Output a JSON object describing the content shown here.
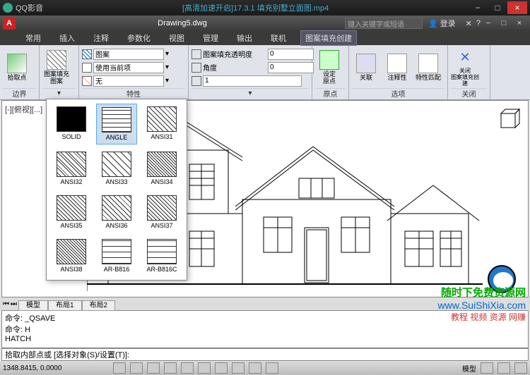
{
  "player": {
    "name": "QQ影音",
    "video_title": "[高清加速开启]17.3.1 填充别墅立面图.mp4"
  },
  "cad": {
    "doc": "Drawing5.dwg",
    "search_placeholder": "键入关键字或短语",
    "user": "登录",
    "menu": [
      "常用",
      "插入",
      "注释",
      "参数化",
      "视图",
      "管理",
      "输出",
      "联机",
      "图案填充创建"
    ],
    "active_menu": 8
  },
  "ribbon": {
    "pick": {
      "label": "拾取点",
      "panel": "边界"
    },
    "pattern_btn": "图案填充\n图案",
    "props": {
      "type": "图案",
      "use_current": "使用当前项",
      "none": "无",
      "panel": "特性"
    },
    "trans": {
      "label": "图案填充透明度",
      "val": "0"
    },
    "angle": {
      "label": "角度",
      "val": "0"
    },
    "scale_val": "1",
    "origin": {
      "label": "设定\n原点",
      "panel": "原点"
    },
    "assoc": "关联",
    "annot": "注释性",
    "match": "特性匹配",
    "options_panel": "选项",
    "close": {
      "label": "关闭\n图案填充创建",
      "panel": "关闭"
    }
  },
  "patterns": [
    "SOLID",
    "ANGLE",
    "ANSI31",
    "ANSI32",
    "ANSI33",
    "ANSI34",
    "ANSI35",
    "ANSI36",
    "ANSI37",
    "ANSI38",
    "AR-B816",
    "AR-B816C"
  ],
  "selected_pattern": 1,
  "view_label": "[-][俯视][...]",
  "layout_tabs": [
    "模型",
    "布局1",
    "布局2"
  ],
  "cmd_lines": [
    "命令: _QSAVE",
    "命令: H",
    "HATCH"
  ],
  "cmd_prompt": "拾取内部点或 [选择对象(S)/设置(T)]:",
  "status": {
    "coords": "1348.8415, 0.0000",
    "space": "模型"
  },
  "watermark": {
    "l1": "随时下免费资源网",
    "l2": "www.SuiShiXia.com",
    "l3": "教程 视频 资源 网赚"
  }
}
